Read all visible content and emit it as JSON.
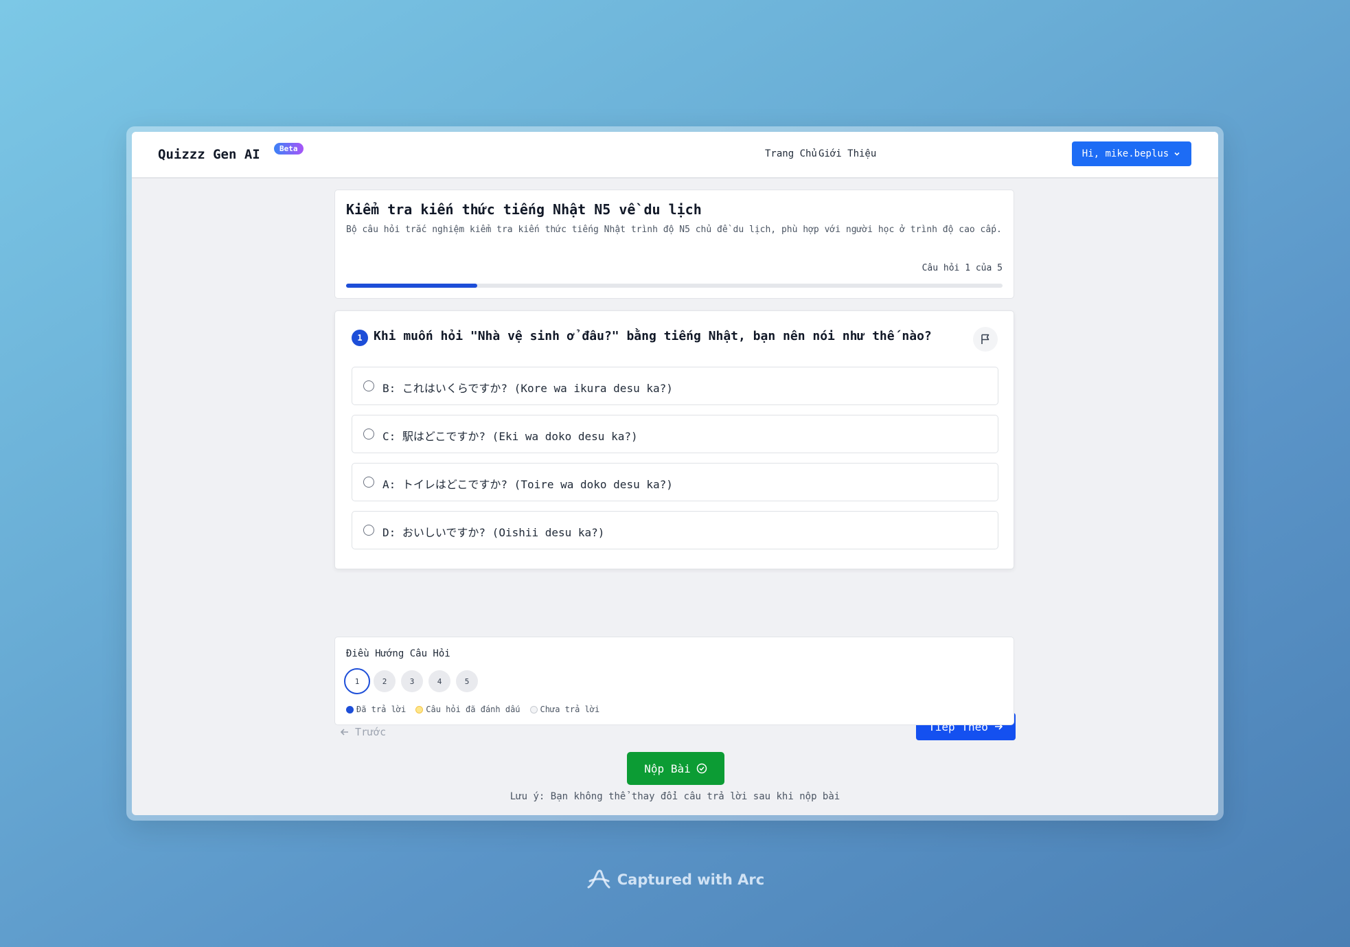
{
  "navbar": {
    "brand": "Quizzz Gen AI",
    "badge": "Beta",
    "links": [
      "Trang Chủ",
      "Giới Thiệu"
    ],
    "user_button": "Hi, mike.beplus"
  },
  "quiz": {
    "title": "Kiểm tra kiến thức tiếng Nhật N5 về du lịch",
    "description": "Bộ câu hỏi trắc nghiệm kiểm tra kiến thức tiếng Nhật trình độ N5 chủ đề du lịch, phù hợp với người học ở trình độ cao cấp.",
    "progress_text": "Câu hỏi 1 của 5",
    "progress_fraction": 0.2
  },
  "question": {
    "number": "1",
    "text": "Khi muốn hỏi \"Nhà vệ sinh ở đâu?\" bằng tiếng Nhật, bạn nên nói như thế nào?",
    "options": [
      "B: これはいくらですか? (Kore wa ikura desu ka?)",
      "C: 駅はどこですか? (Eki wa doko desu ka?)",
      "A: トイレはどこですか? (Toire wa doko desu ka?)",
      "D: おいしいですか? (Oishii desu ka?)"
    ]
  },
  "navigation": {
    "prev_label": "Trước",
    "next_label": "Tiếp Theo",
    "panel_title": "Điều Hướng Câu Hỏi",
    "questions": [
      "1",
      "2",
      "3",
      "4",
      "5"
    ],
    "current": "1",
    "legend": {
      "answered": "Đã trả lời",
      "flagged": "Câu hỏi đã đánh dấu",
      "unanswered": "Chưa trả lời"
    }
  },
  "submit": {
    "label": "Nộp Bài",
    "note": "Lưu ý: Bạn không thể thay đổi câu trả lời sau khi nộp bài"
  },
  "watermark": "Captured with Arc",
  "colors": {
    "primary": "#1d4ed8",
    "next_button": "#1450f0",
    "submit": "#0c9c34",
    "flagged": "#fde68a"
  }
}
